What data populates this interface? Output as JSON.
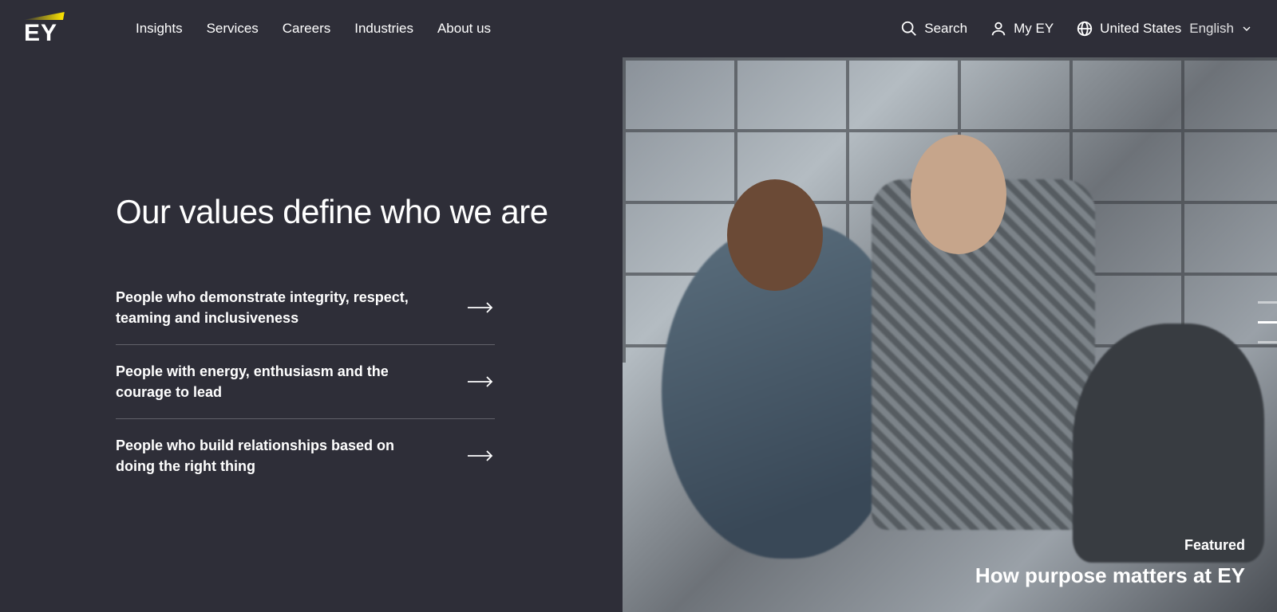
{
  "logo": {
    "text": "EY"
  },
  "nav": {
    "items": [
      "Insights",
      "Services",
      "Careers",
      "Industries",
      "About us"
    ]
  },
  "header_right": {
    "search": "Search",
    "my_ey": "My EY",
    "region": "United States",
    "language": "English"
  },
  "hero": {
    "headline": "Our values define who we are",
    "values": [
      "People who demonstrate integrity, respect, teaming and inclusiveness",
      "People with energy, enthusiasm and the courage to lead",
      "People who build relationships based on doing the right thing"
    ]
  },
  "featured": {
    "label": "Featured",
    "title": "How purpose matters at EY"
  },
  "carousel": {
    "count": 3,
    "active": 1
  }
}
